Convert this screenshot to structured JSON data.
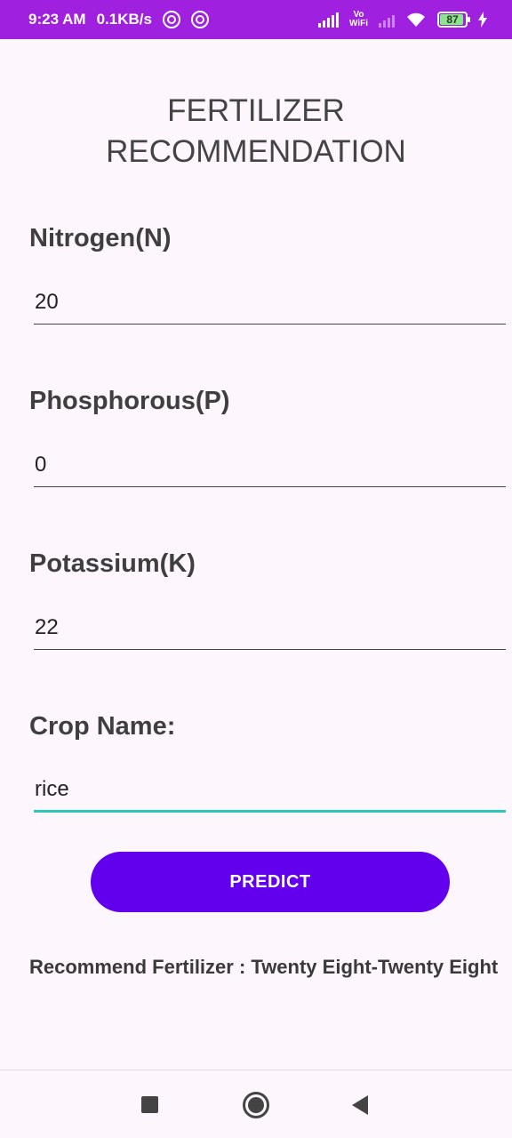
{
  "status_bar": {
    "time": "9:23 AM",
    "speed": "0.1KB/s",
    "vowifi_top": "Vo",
    "vowifi_bottom": "WiFi",
    "battery": "87"
  },
  "title": "FERTILIZER\nRECOMMENDATION",
  "fields": [
    {
      "label": "Nitrogen(N)",
      "value": "20"
    },
    {
      "label": "Phosphorous(P)",
      "value": "0"
    },
    {
      "label": "Potassium(K)",
      "value": "22"
    },
    {
      "label": "Crop Name:",
      "value": "rice"
    }
  ],
  "predict_label": "PREDICT",
  "result_text": "Recommend Fertilizer : Twenty Eight-Twenty Eight",
  "colors": {
    "status_bar": "#A020E0",
    "button": "#6200EE",
    "active_underline": "#2EC6B8",
    "background": "#FDF6FD"
  }
}
